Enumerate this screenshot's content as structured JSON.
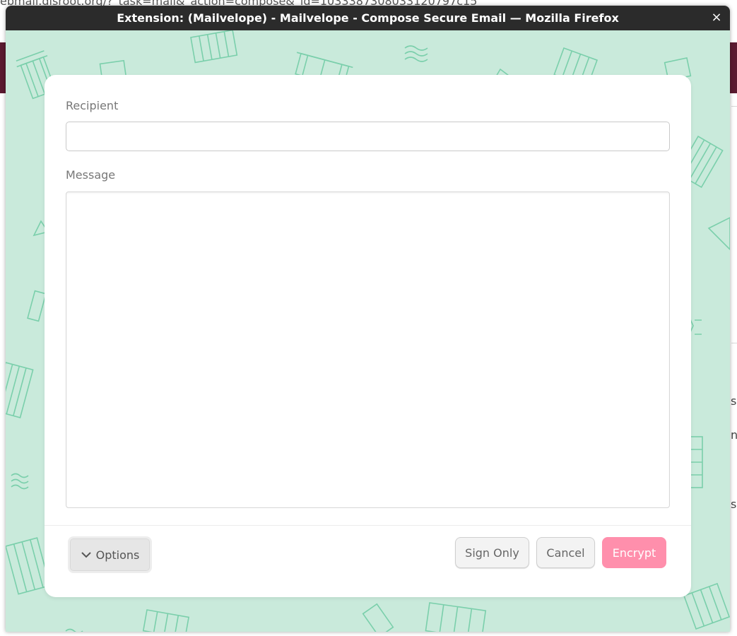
{
  "background_page": {
    "url_fragment": "ebmail.disroot.org/?_task=mail&_action=compose&_id=1033387308033120797c15",
    "side_fragments": [
      "s",
      "ng",
      "ss"
    ]
  },
  "window": {
    "title": "Extension: (Mailvelope) - Mailvelope - Compose Secure Email — Mozilla Firefox",
    "close_icon": "×"
  },
  "form": {
    "recipient_label": "Recipient",
    "recipient_value": "",
    "message_label": "Message",
    "message_value": ""
  },
  "footer": {
    "options_label": "Options",
    "sign_only_label": "Sign Only",
    "cancel_label": "Cancel",
    "encrypt_label": "Encrypt"
  },
  "colors": {
    "titlebar": "#2b2b2b",
    "pattern_background": "#c9eadb",
    "pattern_stroke": "#6ccaa2",
    "encrypt_button": "#ff8fac",
    "background_band": "#5b1a30"
  }
}
